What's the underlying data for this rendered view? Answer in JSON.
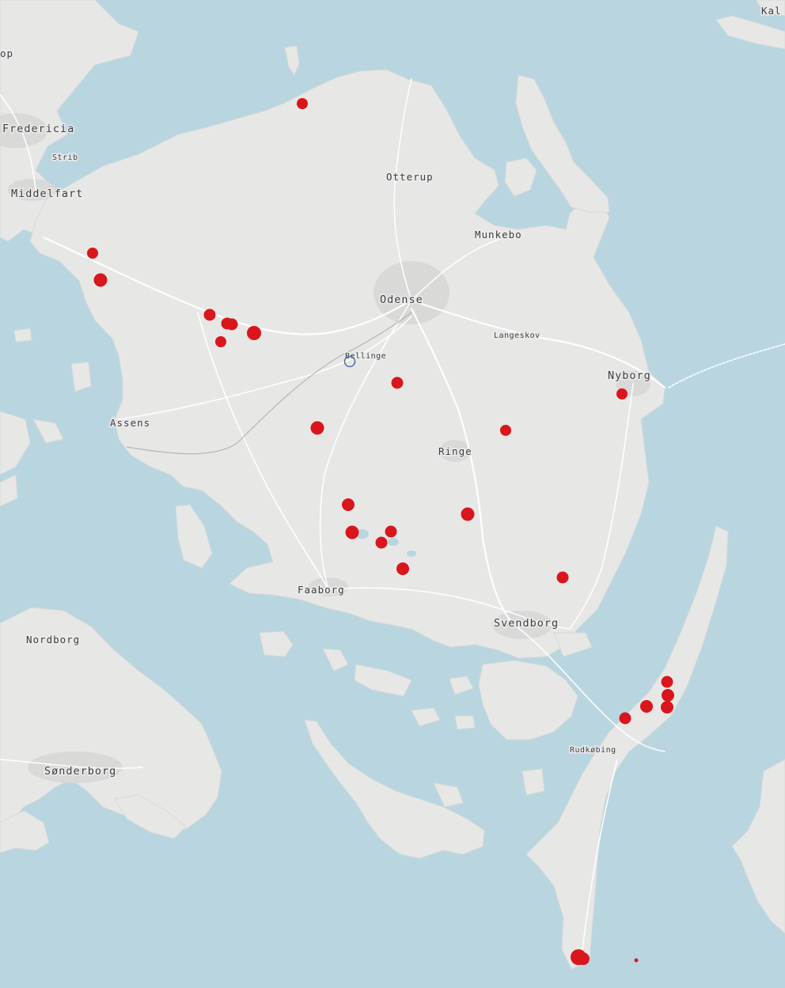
{
  "colors": {
    "water": "#b9d6e0",
    "land": "#e7e8e6",
    "urban": "#d9dad8",
    "marker_fill": "#d9161c",
    "marker_hollow_stroke": "#5a6aa0"
  },
  "places": [
    {
      "id": "kal",
      "text": "Kal"
    },
    {
      "id": "op",
      "text": "op"
    },
    {
      "id": "fredericia",
      "text": "Fredericia"
    },
    {
      "id": "strib",
      "text": "Strib"
    },
    {
      "id": "middelfart",
      "text": "Middelfart"
    },
    {
      "id": "otterup",
      "text": "Otterup"
    },
    {
      "id": "munkebo",
      "text": "Munkebo"
    },
    {
      "id": "odense",
      "text": "Odense"
    },
    {
      "id": "langeskov",
      "text": "Langeskov"
    },
    {
      "id": "bellinge",
      "text": "Bellinge"
    },
    {
      "id": "nyborg",
      "text": "Nyborg"
    },
    {
      "id": "assens",
      "text": "Assens"
    },
    {
      "id": "ringe",
      "text": "Ringe"
    },
    {
      "id": "faaborg",
      "text": "Faaborg"
    },
    {
      "id": "svendborg",
      "text": "Svendborg"
    },
    {
      "id": "nordborg",
      "text": "Nordborg"
    },
    {
      "id": "rudkobing",
      "text": "Rudkøbing"
    },
    {
      "id": "sonderborg",
      "text": "Sønderborg"
    }
  ],
  "markers_count": 31,
  "hollow_markers_count": 1
}
